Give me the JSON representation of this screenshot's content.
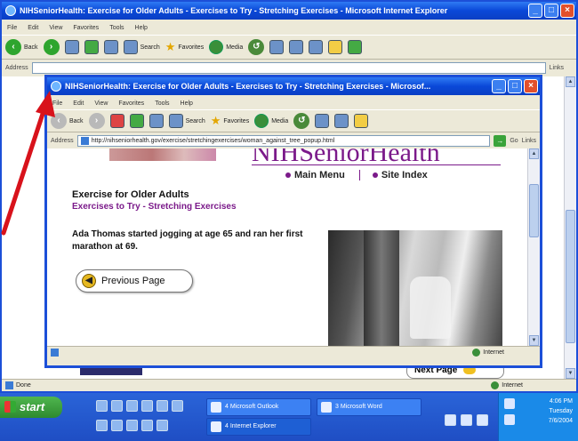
{
  "outer_window": {
    "title": "NIHSeniorHealth: Exercise for Older Adults - Exercises to Try - Stretching Exercises - Microsoft Internet Explorer",
    "menu": [
      "File",
      "Edit",
      "View",
      "Favorites",
      "Tools",
      "Help"
    ],
    "toolbar": {
      "back": "Back",
      "search": "Search",
      "favorites": "Favorites",
      "media": "Media"
    },
    "address_label": "Address",
    "links_label": "Links",
    "status": "Done",
    "zone": "Internet",
    "bg_next_page": "Next Page"
  },
  "popup_window": {
    "title": "NIHSeniorHealth: Exercise for Older Adults - Exercises to Try - Stretching Exercises - Microsof...",
    "menu": [
      "File",
      "Edit",
      "View",
      "Favorites",
      "Tools",
      "Help"
    ],
    "toolbar": {
      "back": "Back",
      "search": "Search",
      "favorites": "Favorites",
      "media": "Media"
    },
    "address_label": "Address",
    "url": "http://nihseniorhealth.gov/exercise/stretchingexercises/woman_against_tree_popup.html",
    "go": "Go",
    "links_label": "Links",
    "zone": "Internet",
    "page": {
      "logo": "NIHSeniorHealth",
      "nav": [
        "Main Menu",
        "Site Index"
      ],
      "heading": "Exercise for Older Adults",
      "subheading": "Exercises to Try - Stretching Exercises",
      "body": "Ada Thomas started jogging at age 65 and ran her first marathon at 69.",
      "prev_button": "Previous Page"
    }
  },
  "taskbar": {
    "start": "start",
    "tasks": [
      "4 Microsoft Outlook",
      "3 Microsoft Word",
      "4 Internet Explorer"
    ],
    "clock": [
      "4:06 PM",
      "Tuesday",
      "7/6/2004"
    ]
  },
  "colors": {
    "accent": "#7b1a8a",
    "xp_blue": "#0a48d8",
    "arrow": "#d8121b"
  }
}
